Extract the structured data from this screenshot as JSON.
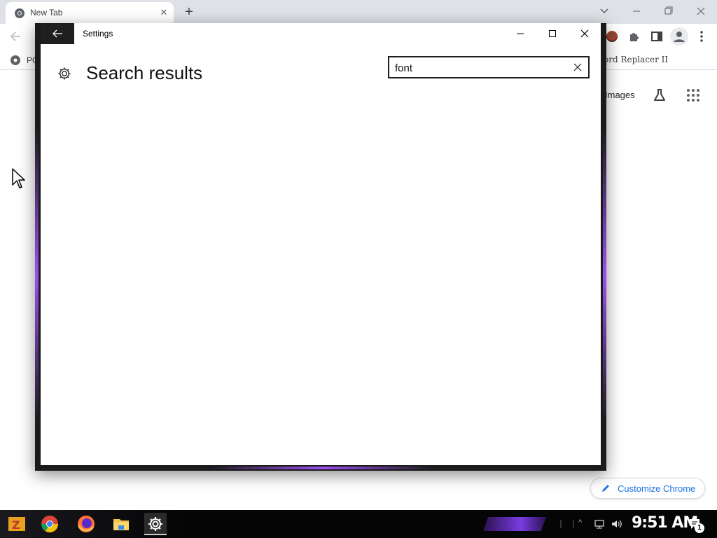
{
  "browser": {
    "tab": {
      "title": "New Tab",
      "close": "✕"
    },
    "new_tab": "+",
    "bookmarks": {
      "left_label": "PC",
      "right_label": "ord Replacer II"
    },
    "ntp": {
      "images_link": "Images"
    },
    "customize_chrome": "Customize Chrome",
    "accent_color": "#1a73e8"
  },
  "settings_window": {
    "title": "Settings",
    "heading": "Search results",
    "search": {
      "value": "font",
      "placeholder": ""
    },
    "glow_color": "#9b4ff0"
  },
  "taskbar": {
    "clock": "9:51 AM",
    "notification_count": "1",
    "apps": [
      "app-launcher-icon",
      "chrome-icon",
      "firefox-icon",
      "file-explorer-icon",
      "settings-icon"
    ]
  }
}
